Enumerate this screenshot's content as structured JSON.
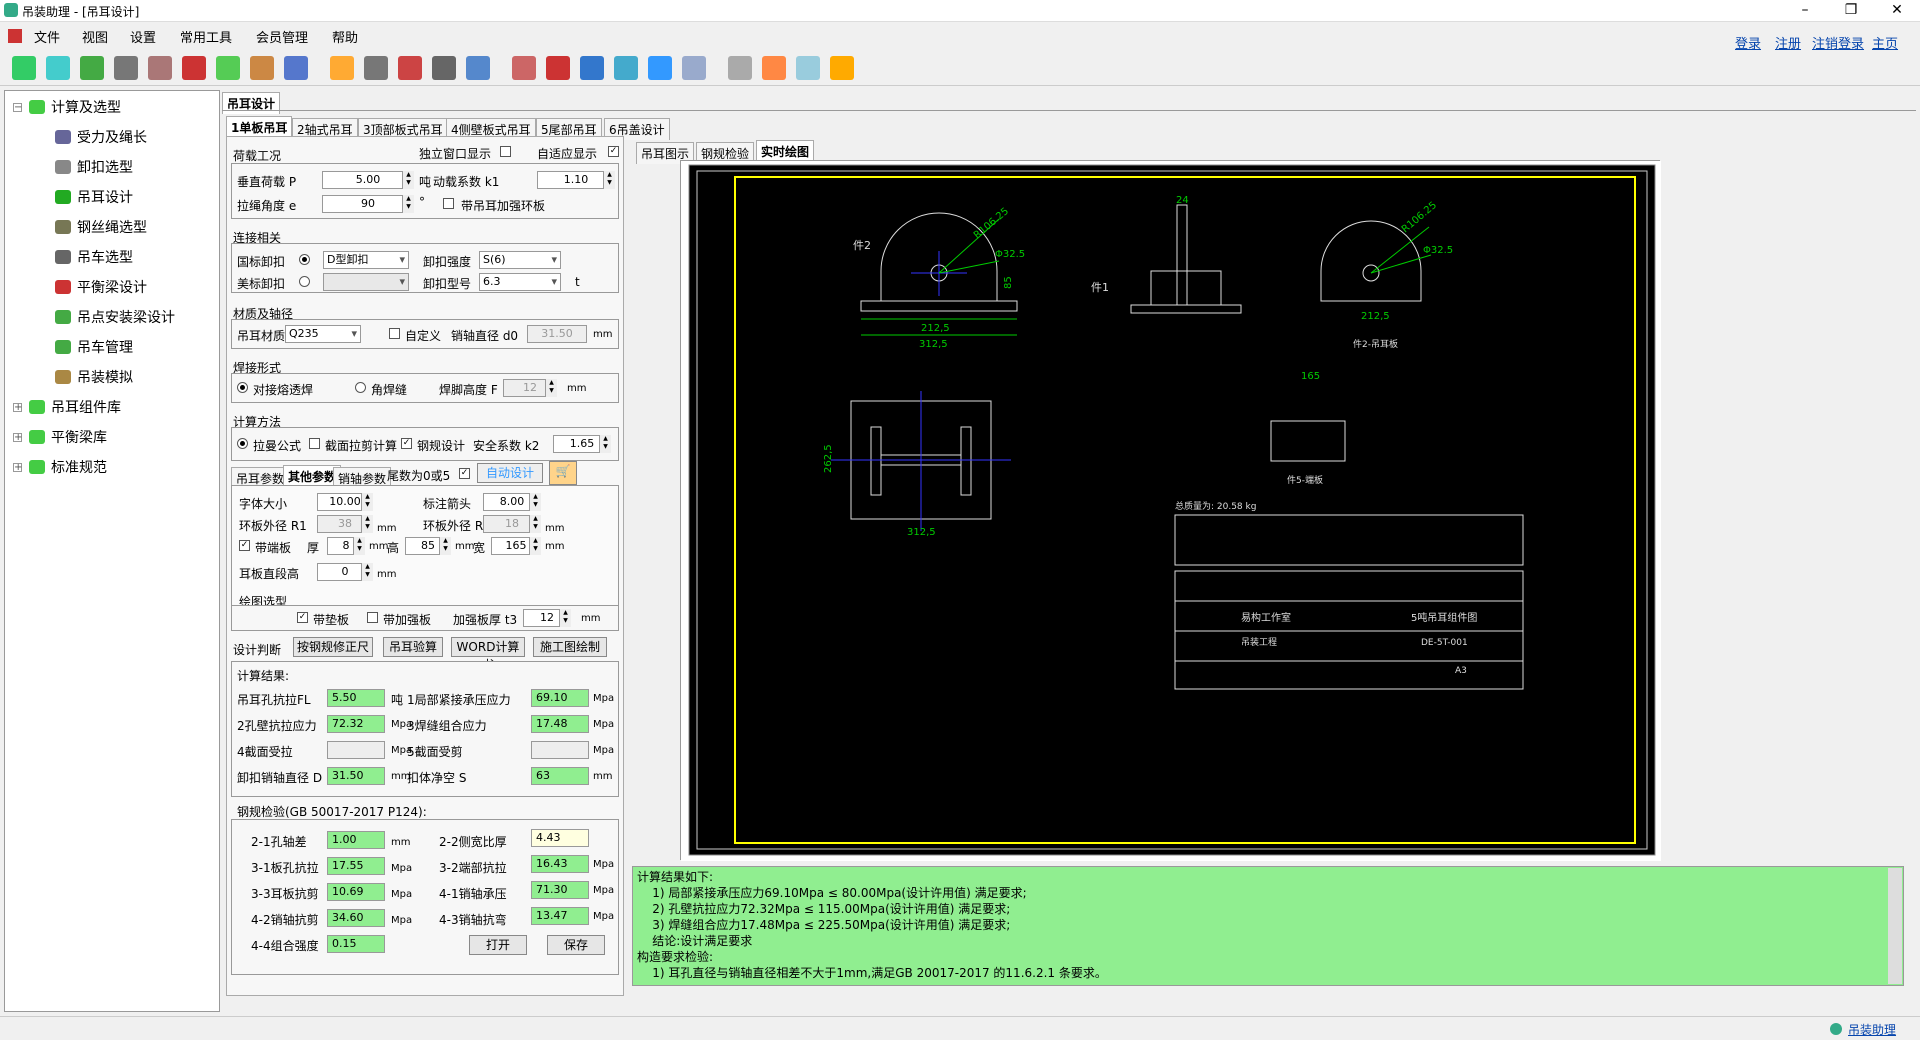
{
  "app": {
    "title": "吊装助理 - [吊耳设计]"
  },
  "menu": [
    "文件",
    "视图",
    "设置",
    "常用工具",
    "会员管理",
    "帮助"
  ],
  "toplinks": [
    "登录",
    "注册",
    "注销登录",
    "主页"
  ],
  "tree": {
    "root1": "计算及选型",
    "children": [
      "受力及绳长",
      "卸扣选型",
      "吊耳设计",
      "钢丝绳选型",
      "吊车选型",
      "平衡梁设计",
      "吊点安装梁设计",
      "吊车管理",
      "吊装模拟"
    ],
    "root2": "吊耳组件库",
    "root3": "平衡梁库",
    "root4": "标准规范"
  },
  "doc_tab": "吊耳设计",
  "subtabs": [
    "1单板吊耳",
    "2轴式吊耳",
    "3顶部板式吊耳",
    "4侧壁板式吊耳",
    "5尾部吊耳",
    "6吊盖设计"
  ],
  "view_tabs": [
    "吊耳图示",
    "钢规检验",
    "实时绘图"
  ],
  "load": {
    "group": "荷载工况",
    "standalone": "独立窗口显示",
    "adaptive": "自适应显示",
    "vload_label": "垂直荷载 P",
    "vload": "5.00",
    "vload_unit": "吨",
    "dyn_label": "动载系数 k1",
    "dyn": "1.10",
    "angle_label": "拉绳角度 e",
    "angle": "90",
    "angle_unit": "°",
    "ring": "带吊耳加强环板"
  },
  "conn": {
    "group": "连接相关",
    "gb_label": "国标卸扣",
    "gb_type": "D型卸扣",
    "str_label": "卸扣强度",
    "str": "S(6)",
    "us_label": "美标卸扣",
    "model_label": "卸扣型号",
    "model": "6.3",
    "model_unit": "t"
  },
  "mat": {
    "group": "材质及轴径",
    "mat_label": "吊耳材质",
    "mat": "Q235",
    "custom": "自定义",
    "pin_label": "销轴直径 d0",
    "pin": "31.50",
    "pin_unit": "mm"
  },
  "weld": {
    "group": "焊接形式",
    "butt": "对接熔透焊",
    "fillet": "角焊缝",
    "height_label": "焊脚高度 F",
    "height": "12",
    "unit": "mm"
  },
  "method": {
    "group": "计算方法",
    "lame": "拉曼公式",
    "shear": "截面拉剪计算",
    "steel": "钢规设计",
    "sf_label": "安全系数 k2",
    "sf": "1.65"
  },
  "param_tabs": [
    "吊耳参数",
    "其他参数",
    "销轴参数"
  ],
  "tail": "尾数为0或5",
  "auto": "自动设计",
  "other": {
    "font_label": "字体大小",
    "font": "10.00",
    "arrow_label": "标注箭头",
    "arrow": "8.00",
    "r1_label": "环板外径 R1",
    "r1": "38",
    "r0_label": "环板外径 R0",
    "r0": "18",
    "mm": "mm",
    "sole_label": "带端板",
    "thick_label": "厚",
    "thick": "8",
    "high_label": "高",
    "high": "85",
    "wide_label": "宽",
    "wide": "165",
    "seg_label": "耳板直段高",
    "seg": "0"
  },
  "draw": {
    "group": "绘图选型",
    "pad": "带垫板",
    "rib": "带加强板",
    "rib_thick_label": "加强板厚 t3",
    "rib_thick": "12",
    "unit": "mm"
  },
  "judge": {
    "group": "设计判断",
    "b1": "按钢规修正尺",
    "b2": "吊耳验算",
    "b3": "WORD计算书",
    "b4": "施工图绘制"
  },
  "results": {
    "title": "计算结果:",
    "r1_label": "吊耳孔抗拉FL",
    "r1": "5.50",
    "r1_unit": "吨",
    "r2_label": "1局部紧接承压应力",
    "r2": "69.10",
    "mpa": "Mpa",
    "r3_label": "2孔壁抗拉应力",
    "r3": "72.32",
    "r4_label": "3焊缝组合应力",
    "r4": "17.48",
    "r5_label": "4截面受拉",
    "r6_label": "5截面受剪",
    "r7_label": "卸扣销轴直径 D",
    "r7": "31.50",
    "r7_unit": "mm",
    "r8_label": "扣体净空 S",
    "r8": "63",
    "r8_unit": "mm"
  },
  "check": {
    "title": "钢规检验(GB 50017-2017 P124):",
    "c1_label": "2-1孔轴差",
    "c1": "1.00",
    "c1_unit": "mm",
    "c2_label": "2-2侧宽比厚",
    "c2": "4.43",
    "c3_label": "3-1板孔抗拉",
    "c3": "17.55",
    "c4_label": "3-2端部抗拉",
    "c4": "16.43",
    "c5_label": "3-3耳板抗剪",
    "c5": "10.69",
    "c6_label": "4-1销轴承压",
    "c6": "71.30",
    "c7_label": "4-2销轴抗剪",
    "c7": "34.60",
    "c8_label": "4-3销轴抗弯",
    "c8": "13.47",
    "c9_label": "4-4组合强度",
    "c9": "0.15",
    "open": "打开",
    "save": "保存"
  },
  "log": [
    "计算结果如下:",
    "    1) 局部紧接承压应力69.10Mpa ≤ 80.00Mpa(设计许用值) 满足要求;",
    "    2) 孔壁抗拉应力72.32Mpa ≤ 115.00Mpa(设计许用值) 满足要求;",
    "    3) 焊缝组合应力17.48Mpa ≤ 225.50Mpa(设计许用值) 满足要求;",
    "    结论:设计满足要求",
    "构造要求检验:",
    "    1) 耳孔直径与销轴直径相差不大于1mm,满足GB 20017-2017 的11.6.2.1 条要求。"
  ],
  "status": "吊装助理",
  "drawing": {
    "part2": "件2",
    "part1": "件1",
    "r1": "R106.25",
    "d1": "Φ32.5",
    "w1": "212,5",
    "w2": "312,5",
    "h85": "85",
    "t24": "24",
    "cap1": "件2-吊耳板",
    "dim165": "165",
    "cap5": "件5-端板",
    "h262": "262,5",
    "total": "总质量为: 20.58 kg",
    "title_block_company": "易构工作室",
    "drawing_name": "5吨吊耳组件图",
    "drawing_no": "DE-5T-001",
    "project": "吊装工程",
    "size": "A3"
  }
}
